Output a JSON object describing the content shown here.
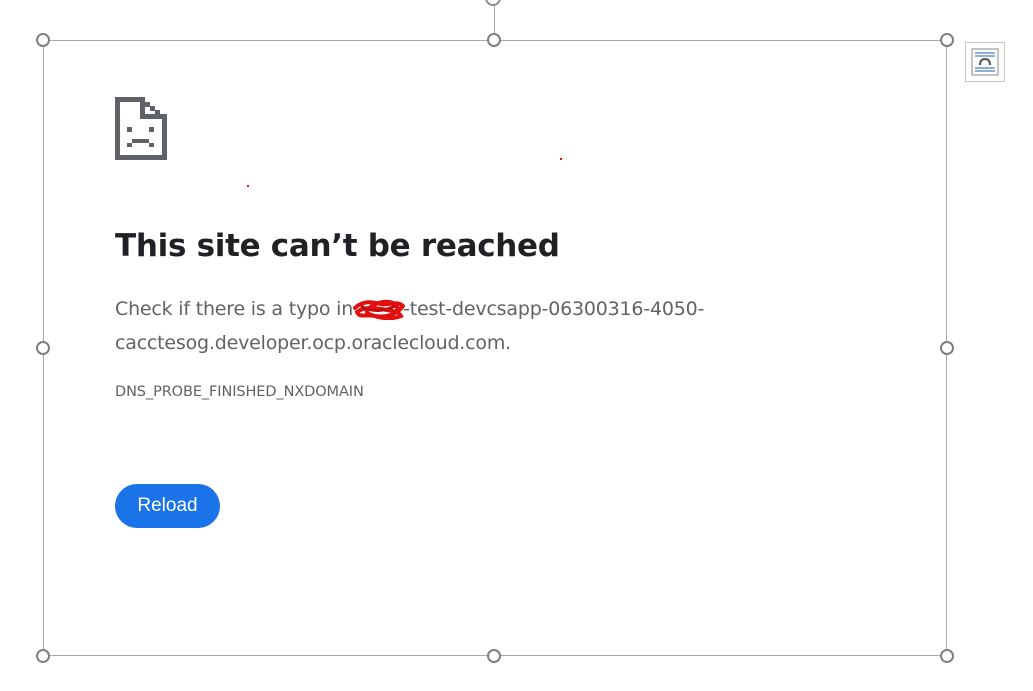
{
  "error_page": {
    "title": "This site can’t be reached",
    "message_prefix": "Check if there is a typo in",
    "message_host_visible": "-test-devcsapp-06300316-4050-cacctesog.developer.ocp.oraclecloud.com.",
    "error_code": "DNS_PROBE_FINISHED_NXDOMAIN",
    "reload_label": "Reload"
  },
  "icons": {
    "sad_page": "sad-page-icon",
    "layout_options": "layout-options-icon",
    "redaction": "red-scribble-redaction"
  },
  "colors": {
    "title": "#202124",
    "body_text": "#5f6368",
    "button_bg": "#1a73e8",
    "button_text": "#ffffff",
    "redaction": "#e01010",
    "frame": "#a9a9a9"
  }
}
